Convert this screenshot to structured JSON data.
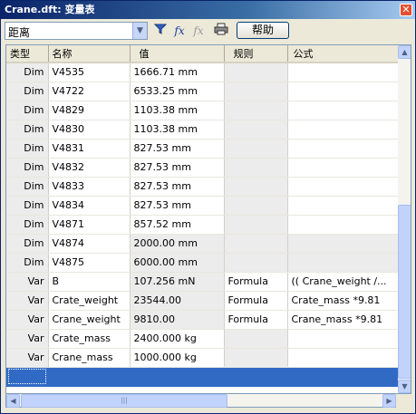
{
  "window": {
    "title": "Crane.dft: 变量表",
    "close_glyph": "✕"
  },
  "toolbar": {
    "filter_value": "距离",
    "help_label": "帮助",
    "icons": [
      "filter-icon",
      "fx-formula-icon",
      "fx-disabled-icon",
      "print-icon"
    ]
  },
  "columns": [
    "类型",
    "名称",
    "值",
    "规则",
    "公式"
  ],
  "rows": [
    {
      "type": "Dim",
      "name": "V4535",
      "value": "1666.71 mm",
      "rule": "",
      "formula": ""
    },
    {
      "type": "Dim",
      "name": "V4722",
      "value": "6533.25 mm",
      "rule": "",
      "formula": ""
    },
    {
      "type": "Dim",
      "name": "V4829",
      "value": "1103.38 mm",
      "rule": "",
      "formula": ""
    },
    {
      "type": "Dim",
      "name": "V4830",
      "value": "1103.38 mm",
      "rule": "",
      "formula": ""
    },
    {
      "type": "Dim",
      "name": "V4831",
      "value": "827.53 mm",
      "rule": "",
      "formula": ""
    },
    {
      "type": "Dim",
      "name": "V4832",
      "value": "827.53 mm",
      "rule": "",
      "formula": ""
    },
    {
      "type": "Dim",
      "name": "V4833",
      "value": "827.53 mm",
      "rule": "",
      "formula": ""
    },
    {
      "type": "Dim",
      "name": "V4834",
      "value": "827.53 mm",
      "rule": "",
      "formula": ""
    },
    {
      "type": "Dim",
      "name": "V4871",
      "value": "857.52 mm",
      "rule": "",
      "formula": ""
    },
    {
      "type": "Dim",
      "name": "V4874",
      "value": "2000.00 mm",
      "rule": "",
      "formula": ""
    },
    {
      "type": "Dim",
      "name": "V4875",
      "value": "6000.00 mm",
      "rule": "",
      "formula": ""
    },
    {
      "type": "Var",
      "name": "B",
      "value": "107.256 mN",
      "rule": "Formula",
      "formula": "(( Crane_weight /..."
    },
    {
      "type": "Var",
      "name": "Crate_weight",
      "value": "23544.00",
      "rule": "Formula",
      "formula": "Crate_mass *9.81"
    },
    {
      "type": "Var",
      "name": "Crane_weight",
      "value": "9810.00",
      "rule": "Formula",
      "formula": "Crane_mass *9.81"
    },
    {
      "type": "Var",
      "name": "Crate_mass",
      "value": "2400.000 kg",
      "rule": "",
      "formula": ""
    },
    {
      "type": "Var",
      "name": "Crane_mass",
      "value": "1000.000 kg",
      "rule": "",
      "formula": ""
    }
  ],
  "colors": {
    "selection": "#316ac5",
    "title_bar": "#0a246a"
  }
}
